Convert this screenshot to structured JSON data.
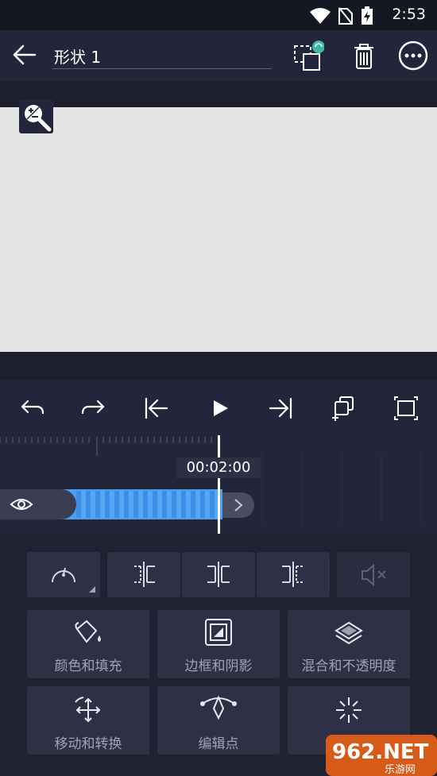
{
  "status": {
    "time": "2:53"
  },
  "header": {
    "title": "形状 1"
  },
  "timeline": {
    "current_time": "00:02:00"
  },
  "panel": {
    "tiles": [
      {
        "label": "颜色和填充"
      },
      {
        "label": "边框和阴影"
      },
      {
        "label": "混合和不透明度"
      },
      {
        "label": "移动和转换"
      },
      {
        "label": "编辑点"
      }
    ]
  },
  "watermark": {
    "text": "962.NET",
    "sub": "乐游网"
  },
  "colors": {
    "accent": "#4a9ff0",
    "background": "#1d1f2e",
    "toolbar": "#23263a",
    "canvas": "#e4e4e4",
    "tile": "#2e3146"
  }
}
